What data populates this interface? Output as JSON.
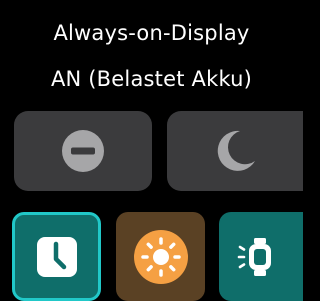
{
  "header": {
    "line1": "Always-on-Display",
    "line2": "AN (Belastet Akku)"
  },
  "toggles": [
    {
      "name": "do-not-disturb",
      "icon": "minus-circle-icon"
    },
    {
      "name": "sleep-mode",
      "icon": "moon-icon"
    }
  ],
  "tiles": [
    {
      "name": "clock-face",
      "icon": "clock-icon",
      "selected": true
    },
    {
      "name": "brightness",
      "icon": "sun-icon",
      "selected": false
    },
    {
      "name": "screen-wake",
      "icon": "watch-wake-icon",
      "selected": false
    }
  ],
  "colors": {
    "background": "#000000",
    "toggle_bg": "#3b3b3d",
    "toggle_icon": "#a6a6a8",
    "teal_tile": "#0f6e6a",
    "teal_highlight": "#21c8c8",
    "brightness_tile": "#5a4124",
    "brightness_icon": "#f5a043"
  }
}
